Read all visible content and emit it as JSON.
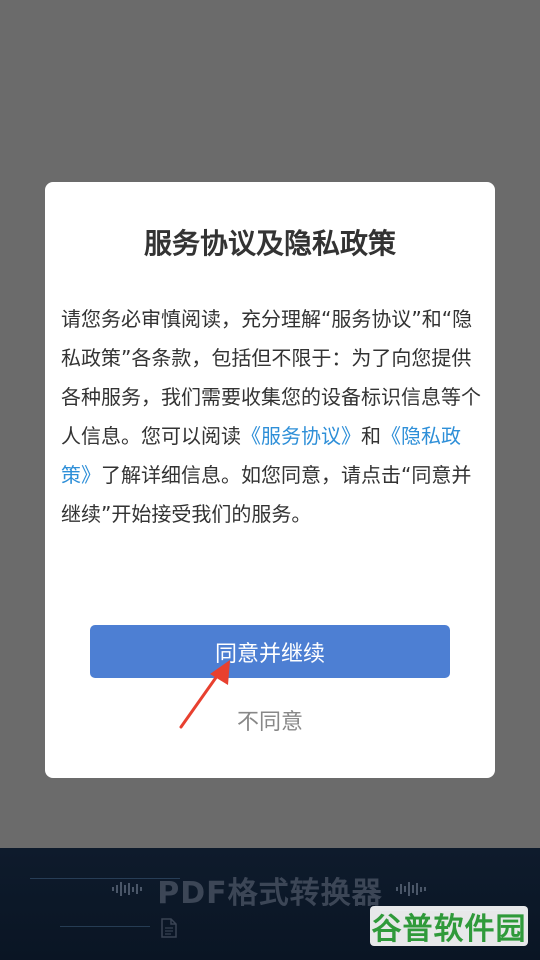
{
  "dialog": {
    "title": "服务协议及隐私政策",
    "body_part1": "请您务必审慎阅读，充分理解“服务协议”和“隐私政策”各条款，包括但不限于：为了向您提供各种服务，我们需要收集您的设备标识信息等个人信息。您可以阅读",
    "link_service": "《服务协议》",
    "body_and": "和",
    "link_privacy": "《隐私政策》",
    "body_part2": "了解详细信息。如您同意，请点击“同意并继续”开始接受我们的服务。",
    "agree_label": "同意并继续",
    "disagree_label": "不同意"
  },
  "banner": {
    "title": "PDF格式转换器"
  },
  "watermark": {
    "text": "谷普软件园"
  },
  "colors": {
    "overlay": "#6b6b6b",
    "link": "#2e8fd8",
    "agree_button": "#4d7fd3",
    "arrow": "#e8402f"
  },
  "icons": [
    "document-icon",
    "pointer-arrow-icon"
  ]
}
